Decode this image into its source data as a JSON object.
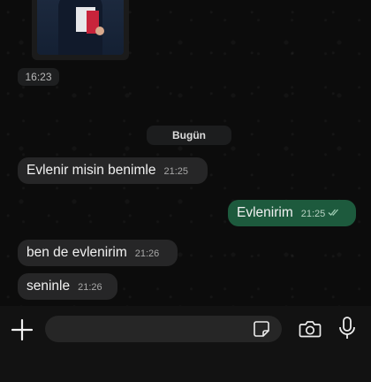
{
  "conversation": {
    "earlier_time": "16:23",
    "date_separator": "Bugün"
  },
  "messages": [
    {
      "direction": "incoming",
      "text": "Evlenir misin benimle",
      "time": "21:25"
    },
    {
      "direction": "outgoing",
      "text": "Evlenirim",
      "time": "21:25",
      "status": "read"
    },
    {
      "direction": "incoming",
      "text": "ben de evlenirim",
      "time": "21:26"
    },
    {
      "direction": "incoming",
      "text": "seninle",
      "time": "21:26"
    }
  ],
  "composer": {
    "placeholder": "",
    "icons": [
      "plus-icon",
      "sticker-icon",
      "camera-icon",
      "microphone-icon"
    ]
  },
  "colors": {
    "incoming_bubble": "#262627",
    "outgoing_bubble": "#1d5a3d",
    "read_ticks": "#9ecdb3"
  }
}
